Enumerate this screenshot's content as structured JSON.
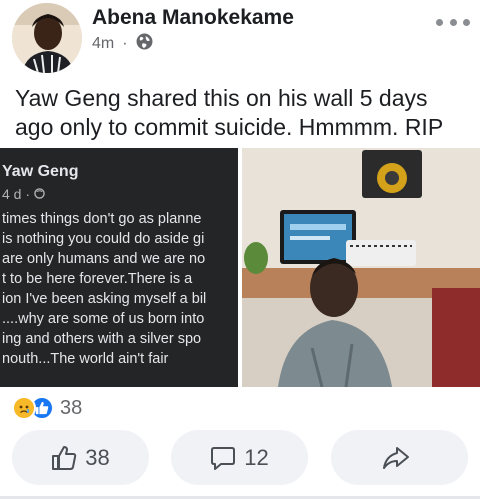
{
  "post": {
    "author": "Abena Manokekame",
    "time": "4m",
    "meta_separator": "·",
    "text_lines": [
      "Yaw Geng shared this on his wall 5 days",
      "ago only to commit suicide. Hmmmm. RIP"
    ]
  },
  "shared_post": {
    "author": "Yaw Geng",
    "meta": "4 d · ",
    "lines": [
      "times things don't go as planne",
      "is nothing you could do aside gi",
      "are only humans and we are no",
      "t to be here forever.There is a",
      "ion I've been asking myself a bil",
      "....why are some of us born into",
      "ing and others with a silver spo",
      "nouth...The world ain't fair"
    ]
  },
  "reactions": {
    "count": "38",
    "icons": [
      "sad-reaction-icon",
      "like-reaction-icon"
    ]
  },
  "actions": {
    "like_count": "38",
    "comment_count": "12"
  },
  "colors": {
    "card_dark": "#242526",
    "like_blue": "#1877f2",
    "sad_yellow": "#f7b928",
    "button_bg": "#f0f2f5"
  }
}
